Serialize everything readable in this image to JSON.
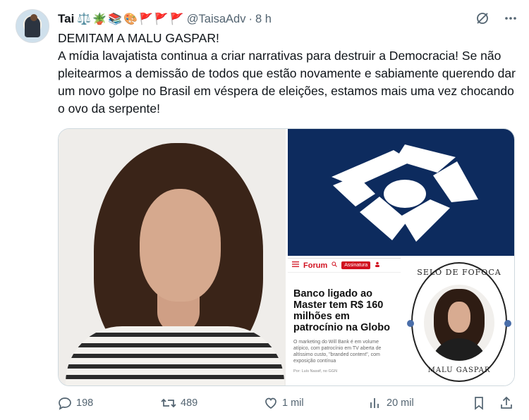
{
  "author": {
    "name": "Tai",
    "emojis": [
      "⚖️",
      "🪴",
      "📚",
      "🎨",
      "🚩",
      "🚩",
      "🚩"
    ],
    "handle": "@TaisaAdv",
    "separator": "·",
    "time": "8 h"
  },
  "tweet": {
    "line1": "DEMITAM A MALU GASPAR!",
    "paragraph": "A mídia lavajatista continua a criar narrativas para destruir a Democracia! Se não pleitearmos a demissão de todos que estão novamente e sabiamente querendo dar um novo golpe no Brasil em véspera de eleições, estamos mais uma vez chocando o ovo da serpente!"
  },
  "media": {
    "forum": {
      "logo": "Forum",
      "button": "Assinatura",
      "headline": "Banco ligado ao Master tem R$ 160 milhões em patrocínio na Globo",
      "subtitle": "O marketing do Will Bank é em volume atípico, com patrocínio em TV aberta de altíssimo custo, \"branded content\", com exposição contínua",
      "byline": "Por: Luís Nassif, no GGN"
    },
    "selo": {
      "top_text": "SELO DE FOFOCA",
      "bottom_text": "MALU GASPAR"
    }
  },
  "actions": {
    "replies": "198",
    "reposts": "489",
    "likes": "1 mil",
    "views": "20 mil"
  },
  "icons": {
    "grok": "grok-icon",
    "more": "more-icon",
    "reply": "reply-icon",
    "repost": "repost-icon",
    "like": "heart-icon",
    "views": "views-icon",
    "bookmark": "bookmark-icon",
    "share": "share-icon"
  },
  "colors": {
    "text": "#0f1419",
    "secondary": "#536471",
    "forum_red": "#d1101f",
    "rf_navy": "#0d2b5e"
  }
}
